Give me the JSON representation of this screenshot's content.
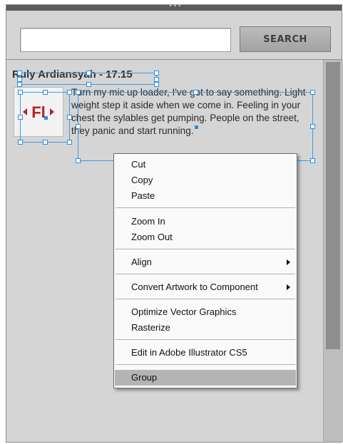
{
  "search": {
    "input_value": "",
    "button_label": "SEARCH"
  },
  "post": {
    "title": "Ruly Ardiansyah - 17.15",
    "text": "Turn my mic up loader, I've got to say something. Light weight step it aside when we come in. Feeling in your chest the sylables get pumping. People on the street, they panic and start running.",
    "avatar_icon": "flash-logo-icon",
    "avatar_text": "Fl",
    "avatar_color": "#b8202a"
  },
  "context_menu": {
    "items": [
      {
        "label": "Cut"
      },
      {
        "label": "Copy"
      },
      {
        "label": "Paste"
      },
      {
        "label": "Zoom In"
      },
      {
        "label": "Zoom Out"
      },
      {
        "label": "Align"
      },
      {
        "label": "Convert Artwork to Component"
      },
      {
        "label": "Optimize Vector Graphics"
      },
      {
        "label": "Rasterize"
      },
      {
        "label": "Edit in Adobe Illustrator CS5"
      },
      {
        "label": "Group"
      }
    ],
    "highlight_color": "#b4b4b4"
  }
}
